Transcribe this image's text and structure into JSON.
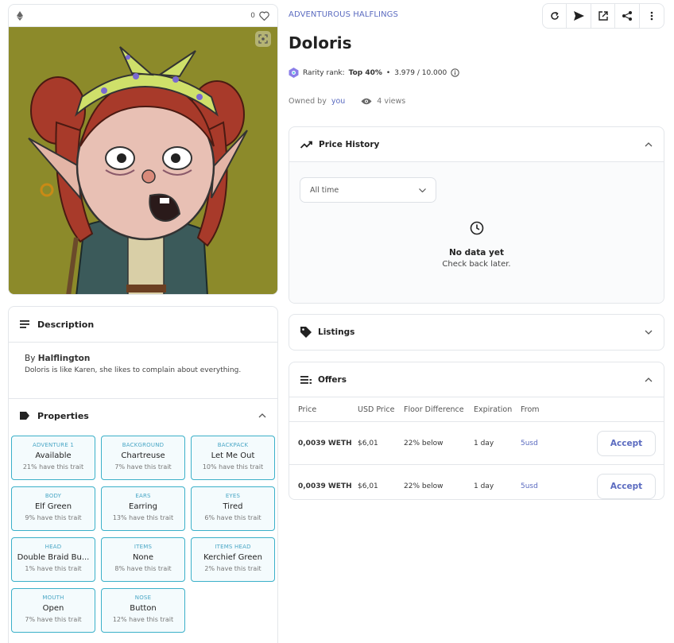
{
  "media": {
    "chain_icon": "ethereum-icon",
    "like_count": "0",
    "like_icon": "heart-icon",
    "zoom_icon": "expand-icon",
    "background_color": "#8c8a2a"
  },
  "collection": "ADVENTUROUS HALFLINGS",
  "title": "Doloris",
  "rarity": {
    "label": "Rarity rank:",
    "rank": "Top 40%",
    "separator": "•",
    "score": "3.979 / 10.000"
  },
  "owner": {
    "prefix": "Owned by",
    "name": "you",
    "views": "4 views"
  },
  "toolbar": {
    "icons": [
      "refresh-icon",
      "send-icon",
      "external-link-icon",
      "share-icon",
      "more-vertical-icon"
    ]
  },
  "description": {
    "heading": "Description",
    "by_prefix": "By",
    "author": "Halflington",
    "text": "Doloris is like Karen, she likes to complain about everything."
  },
  "properties": {
    "heading": "Properties",
    "traits": [
      {
        "type": "ADVENTURE 1",
        "value": "Available",
        "rarity": "21% have this trait"
      },
      {
        "type": "BACKGROUND",
        "value": "Chartreuse",
        "rarity": "7% have this trait"
      },
      {
        "type": "BACKPACK",
        "value": "Let Me Out",
        "rarity": "10% have this trait"
      },
      {
        "type": "BODY",
        "value": "Elf Green",
        "rarity": "9% have this trait"
      },
      {
        "type": "EARS",
        "value": "Earring",
        "rarity": "13% have this trait"
      },
      {
        "type": "EYES",
        "value": "Tired",
        "rarity": "6% have this trait"
      },
      {
        "type": "HEAD",
        "value": "Double Braid Bu...",
        "rarity": "1% have this trait"
      },
      {
        "type": "ITEMS",
        "value": "None",
        "rarity": "8% have this trait"
      },
      {
        "type": "ITEMS HEAD",
        "value": "Kerchief Green",
        "rarity": "2% have this trait"
      },
      {
        "type": "MOUTH",
        "value": "Open",
        "rarity": "7% have this trait"
      },
      {
        "type": "NOSE",
        "value": "Button",
        "rarity": "12% have this trait"
      }
    ]
  },
  "price_history": {
    "heading": "Price History",
    "range": "All time",
    "empty_title": "No data yet",
    "empty_text": "Check back later."
  },
  "listings": {
    "heading": "Listings"
  },
  "offers": {
    "heading": "Offers",
    "columns": [
      "Price",
      "USD Price",
      "Floor Difference",
      "Expiration",
      "From"
    ],
    "rows": [
      {
        "price": "0,0039 WETH",
        "usd": "$6,01",
        "floor": "22% below",
        "expiration": "1 day",
        "from": "5usd",
        "action": "Accept"
      },
      {
        "price": "0,0039 WETH",
        "usd": "$6,01",
        "floor": "22% below",
        "expiration": "1 day",
        "from": "5usd",
        "action": "Accept"
      }
    ]
  },
  "colors": {
    "accent": "#5b6bc0",
    "trait_border": "#3bb0c9"
  }
}
